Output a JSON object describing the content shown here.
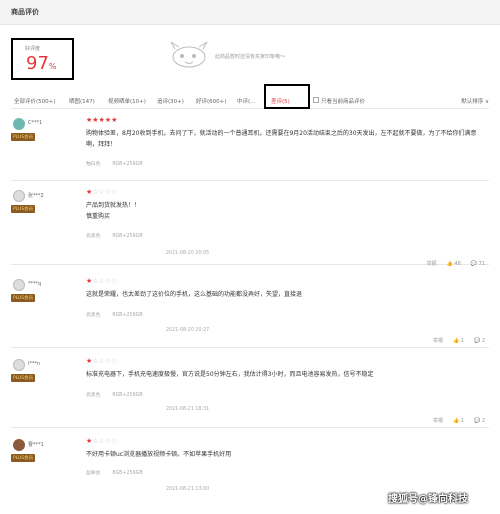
{
  "header": {
    "title": "商品评价"
  },
  "rating": {
    "label": "好评度",
    "value": "97",
    "unit": "%"
  },
  "empty_note": "此商品暂时还没有买家印象哦～",
  "tabs": [
    {
      "label": "全部评价(500+)"
    },
    {
      "label": "晒图(147)"
    },
    {
      "label": "视频晒单(10+)"
    },
    {
      "label": "追评(30+)"
    },
    {
      "label": "好评(600+)"
    },
    {
      "label": "中评(..."
    },
    {
      "label": "差评(5)"
    },
    {
      "label": "只看当前商品评价"
    }
  ],
  "sort": "默认排序 ∨",
  "reviews": [
    {
      "user": "C***1",
      "badge": "PLUS会员",
      "stars_on": 5,
      "stars_off": 0,
      "text": "购物体验差，8月20收到手机，去问了下，就活动的一个普通耳机，还需要在9月20活动结束之后的30天发出，左不起就不要做，为了不给你们满意啊，拜拜！",
      "color": "釉白色",
      "spec": "8GB+256GB",
      "date": "",
      "report": "",
      "likes": "",
      "comments": ""
    },
    {
      "user": "张***2",
      "badge": "PLUS会员",
      "stars_on": 1,
      "stars_off": 4,
      "text": "产品到货就发热！！\n慎重购买",
      "color": "亮黑色",
      "spec": "8GB+256GB",
      "date": "2021-08-20 20:05",
      "report": "举报",
      "likes": "48",
      "comments": "71"
    },
    {
      "user": "****q",
      "badge": "PLUS会员",
      "stars_on": 1,
      "stars_off": 4,
      "text": "这就是荣耀，也太差劲了这价位的手机，这么基础的功能都没弄好，失望，直接退",
      "color": "亮黑色",
      "spec": "8GB+256GB",
      "date": "2021-08-20 20:27",
      "report": "举报",
      "likes": "1",
      "comments": "2"
    },
    {
      "user": "l***n",
      "badge": "PLUS会员",
      "stars_on": 1,
      "stars_off": 4,
      "text": "标准充电器下，手机充电速度极慢，官方说是50分钟左右，我估计得3小时，而且电池容易发热，信号不稳定",
      "color": "亮黑色",
      "spec": "8GB+256GB",
      "date": "2021-08-21 18:31",
      "report": "举报",
      "likes": "1",
      "comments": "2"
    },
    {
      "user": "曹***1",
      "badge": "PLUS会员",
      "stars_on": 1,
      "stars_off": 4,
      "text": "不好用卡顿uc浏览器播放视频卡顿。不如苹果手机好用",
      "color": "盈眸金",
      "spec": "8GB+256GB",
      "date": "2021-08-21 13:00",
      "report": "",
      "likes": "",
      "comments": ""
    }
  ],
  "watermark": "搜狐号@锋向科技",
  "colors": {
    "accent": "#e4393c",
    "plus_bg": "#8a5a1f",
    "plus_text": "#f5d27c"
  }
}
